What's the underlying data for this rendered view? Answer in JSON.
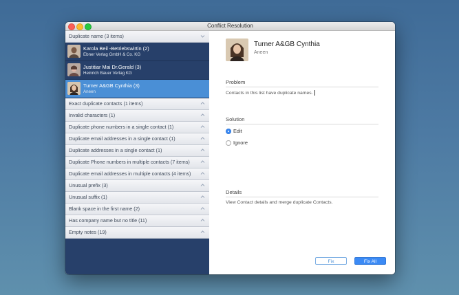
{
  "window": {
    "title": "Conflict Resolution"
  },
  "sidebar": {
    "groups": [
      {
        "label": "Duplicate name (3 items)",
        "expanded": true,
        "items": [
          {
            "name": "Karola Beil -Betriebswirtin (2)",
            "sub": "Ebner Verlag GmbH & Co. KG",
            "selected": false
          },
          {
            "name": "Justitiar Mai Dr.Gerald (3)",
            "sub": "Heinrich Bauer Verlag KG",
            "selected": false
          },
          {
            "name": "Turner A&GB Cynthia (3)",
            "sub": "Aneen",
            "selected": true
          }
        ]
      },
      {
        "label": "Exact duplicate contacts (1 items)"
      },
      {
        "label": "Invalid characters (1)"
      },
      {
        "label": "Duplicate phone numbers in a single contact (1)"
      },
      {
        "label": "Duplicate email addresses in a single contact (1)"
      },
      {
        "label": "Duplicate addresses in a single contact (1)"
      },
      {
        "label": "Duplicate Phone numbers in multiple contacts (7 items)"
      },
      {
        "label": "Duplicate email addresses in multiple contacts (4 items)"
      },
      {
        "label": "Unusual prefix (3)"
      },
      {
        "label": "Unusual suffix (1)"
      },
      {
        "label": "Blank space in the first name (2)"
      },
      {
        "label": "Has company name but no title (11)"
      },
      {
        "label": "Empty notes (19)"
      }
    ]
  },
  "detail": {
    "contact_name": "Turner A&GB Cynthia",
    "contact_sub": "Aneen",
    "problem": {
      "title": "Problem",
      "text": "Contacts in this list have duplicate names."
    },
    "solution": {
      "title": "Solution",
      "options": [
        "Edit",
        "Ignore"
      ],
      "selected": "Edit"
    },
    "details": {
      "title": "Details",
      "text": "View Contact details and merge duplicate Contacts."
    },
    "buttons": {
      "fix": "Fix",
      "fix_all": "Fix All"
    }
  },
  "colors": {
    "sidebar_bg": "#27406a",
    "selection": "#4a8fd6",
    "accent": "#3b8af5"
  }
}
